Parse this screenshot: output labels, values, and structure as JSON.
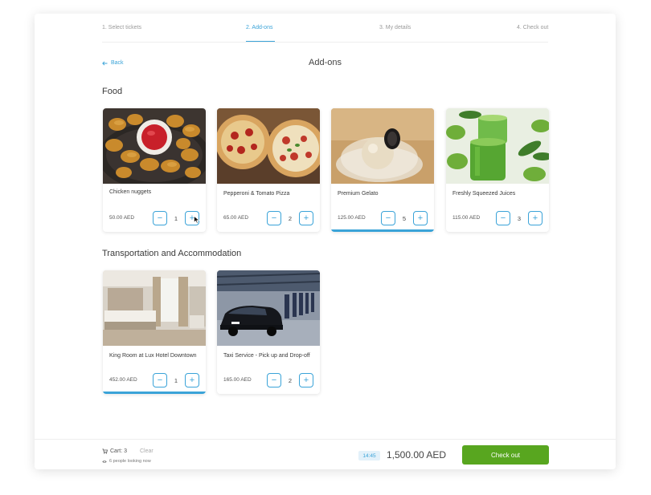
{
  "steps": [
    {
      "label": "1. Select tickets"
    },
    {
      "label": "2. Add-ons"
    },
    {
      "label": "3. My details"
    },
    {
      "label": "4. Check out"
    }
  ],
  "back_label": "Back",
  "page_title": "Add-ons",
  "sections": {
    "food": {
      "title": "Food",
      "items": [
        {
          "name": "Chicken nuggets",
          "price": "50.00 AED",
          "qty": "1"
        },
        {
          "name": "Pepperoni & Tomato Pizza",
          "price": "65.00 AED",
          "qty": "2"
        },
        {
          "name": "Premium Gelato",
          "price": "125.00 AED",
          "qty": "5"
        },
        {
          "name": "Freshly Squeezed Juices",
          "price": "115.00 AED",
          "qty": "3"
        }
      ]
    },
    "transport": {
      "title": "Transportation and Accommodation",
      "items": [
        {
          "name": "King Room at Lux Hotel Downtown",
          "price": "452.00 AED",
          "qty": "1"
        },
        {
          "name": "Taxi Service - Pick up and Drop-off",
          "price": "165.00 AED",
          "qty": "2"
        }
      ]
    }
  },
  "stepper": {
    "minus": "−",
    "plus": "+"
  },
  "footer": {
    "cart": "Cart: 3",
    "clear": "Clear",
    "looking": "6 people looking now",
    "timer": "14:45",
    "total": "1,500.00 AED",
    "checkout": "Check out"
  },
  "colors": {
    "accent": "#3aa3d8",
    "checkout": "#58a61f"
  }
}
